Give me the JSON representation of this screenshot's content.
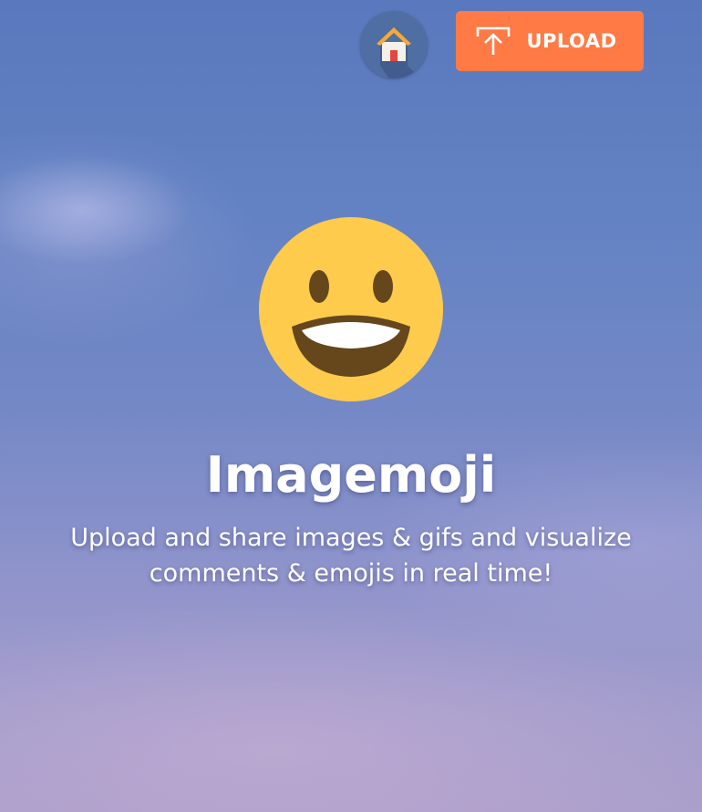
{
  "nav": {
    "home_icon": "house-icon",
    "upload_icon": "upload-arrow-icon",
    "upload_label": "UPLOAD"
  },
  "hero": {
    "emoji_icon": "grinning-face-emoji",
    "title": "Imagemoji",
    "tagline": "Upload and share images & gifs and visualize comments & emojis in real time!"
  },
  "colors": {
    "upload_button": "#ff7a45",
    "home_button": "#4f6ea3",
    "emoji_face": "#ffcb4c",
    "emoji_features": "#65471b",
    "text": "#ffffff"
  }
}
